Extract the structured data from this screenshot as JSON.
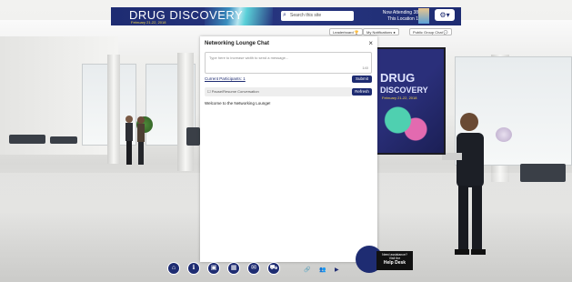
{
  "brand": {
    "title": "DRUG DISCOVERY",
    "date": "February 21-22, 2018"
  },
  "search": {
    "placeholder": "Search this site",
    "icon": "search-icon"
  },
  "attendance": {
    "line1": "Now Attending",
    "line2": "This Location",
    "count1": "38",
    "count2": "1"
  },
  "top_buttons": {
    "leaderboard": "Leaderboard",
    "notifications": "My Notifications",
    "public_chat": "Public Group Chat"
  },
  "screen": {
    "line1": "DRUG",
    "line2": "DISCOVERY",
    "sub": "February 21-22, 2018"
  },
  "chat": {
    "title": "Networking Lounge Chat",
    "close": "×",
    "placeholder": "Type here to increase width to send a message...",
    "counter": "140",
    "participants": "Current Participants: 1",
    "submit": "Submit",
    "refresh": "Refresh",
    "status": "Pause/Resume Conversation",
    "welcome": "Welcome to the Networking Lounge!"
  },
  "help": {
    "line1": "Need assistance?",
    "line2": "Visit the",
    "title": "Help Desk"
  },
  "colors": {
    "brand": "#1e2c72",
    "accent": "#f3d94a"
  }
}
